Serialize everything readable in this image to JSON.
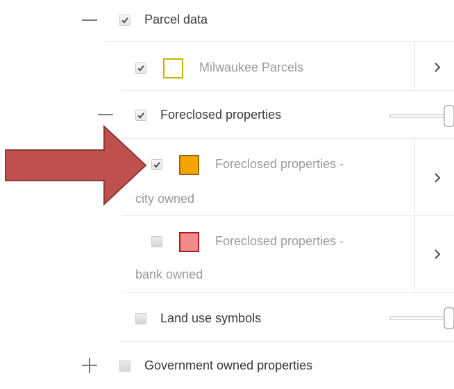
{
  "layers": {
    "parcel_data": {
      "label": "Parcel data",
      "expander": "minus",
      "checked": true
    },
    "milwaukee_parcels": {
      "label": "Milwaukee Parcels",
      "checked": true,
      "swatch_fill": "#ffffff",
      "swatch_border": "#c8b400"
    },
    "foreclosed_properties": {
      "label": "Foreclosed properties",
      "expander": "minus",
      "checked": true
    },
    "foreclosed_city": {
      "label_line1": "Foreclosed properties -",
      "label_line2": "city owned",
      "checked": true,
      "swatch_fill": "#f5a500",
      "swatch_border": "#9a6a00"
    },
    "foreclosed_bank": {
      "label_line1": "Foreclosed properties -",
      "label_line2": "bank owned",
      "checked": false,
      "swatch_fill": "#f28b8b",
      "swatch_border": "#b01a1a"
    },
    "land_use_symbols": {
      "label": "Land use symbols",
      "checked": false
    },
    "government_owned": {
      "label": "Government owned properties",
      "expander": "plus",
      "checked": false
    }
  },
  "icons": {
    "expander_collapse": "minus-icon",
    "expander_expand": "plus-icon",
    "more": "chevron-right-icon",
    "annotation": "arrow-right-annotation"
  },
  "colors": {
    "annotation_arrow_fill": "#c0504d",
    "annotation_arrow_stroke": "#8c3836"
  }
}
